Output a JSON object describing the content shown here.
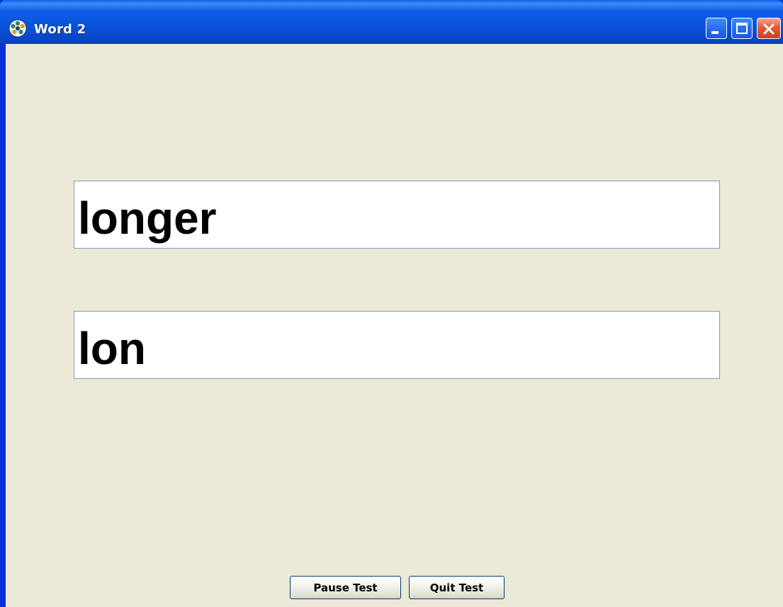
{
  "window": {
    "title": "Word 2",
    "icon": "gear-icon",
    "controls": [
      "minimize-icon",
      "maximize-icon",
      "close-icon"
    ]
  },
  "fields": {
    "target_word": "longer",
    "typed_word": "lon"
  },
  "buttons": {
    "pause_label": "Pause Test",
    "quit_label": "Quit Test"
  },
  "colors": {
    "titlebar": "#0A53DB",
    "background": "#ECE9D8",
    "close_button": "#E45E3A"
  }
}
